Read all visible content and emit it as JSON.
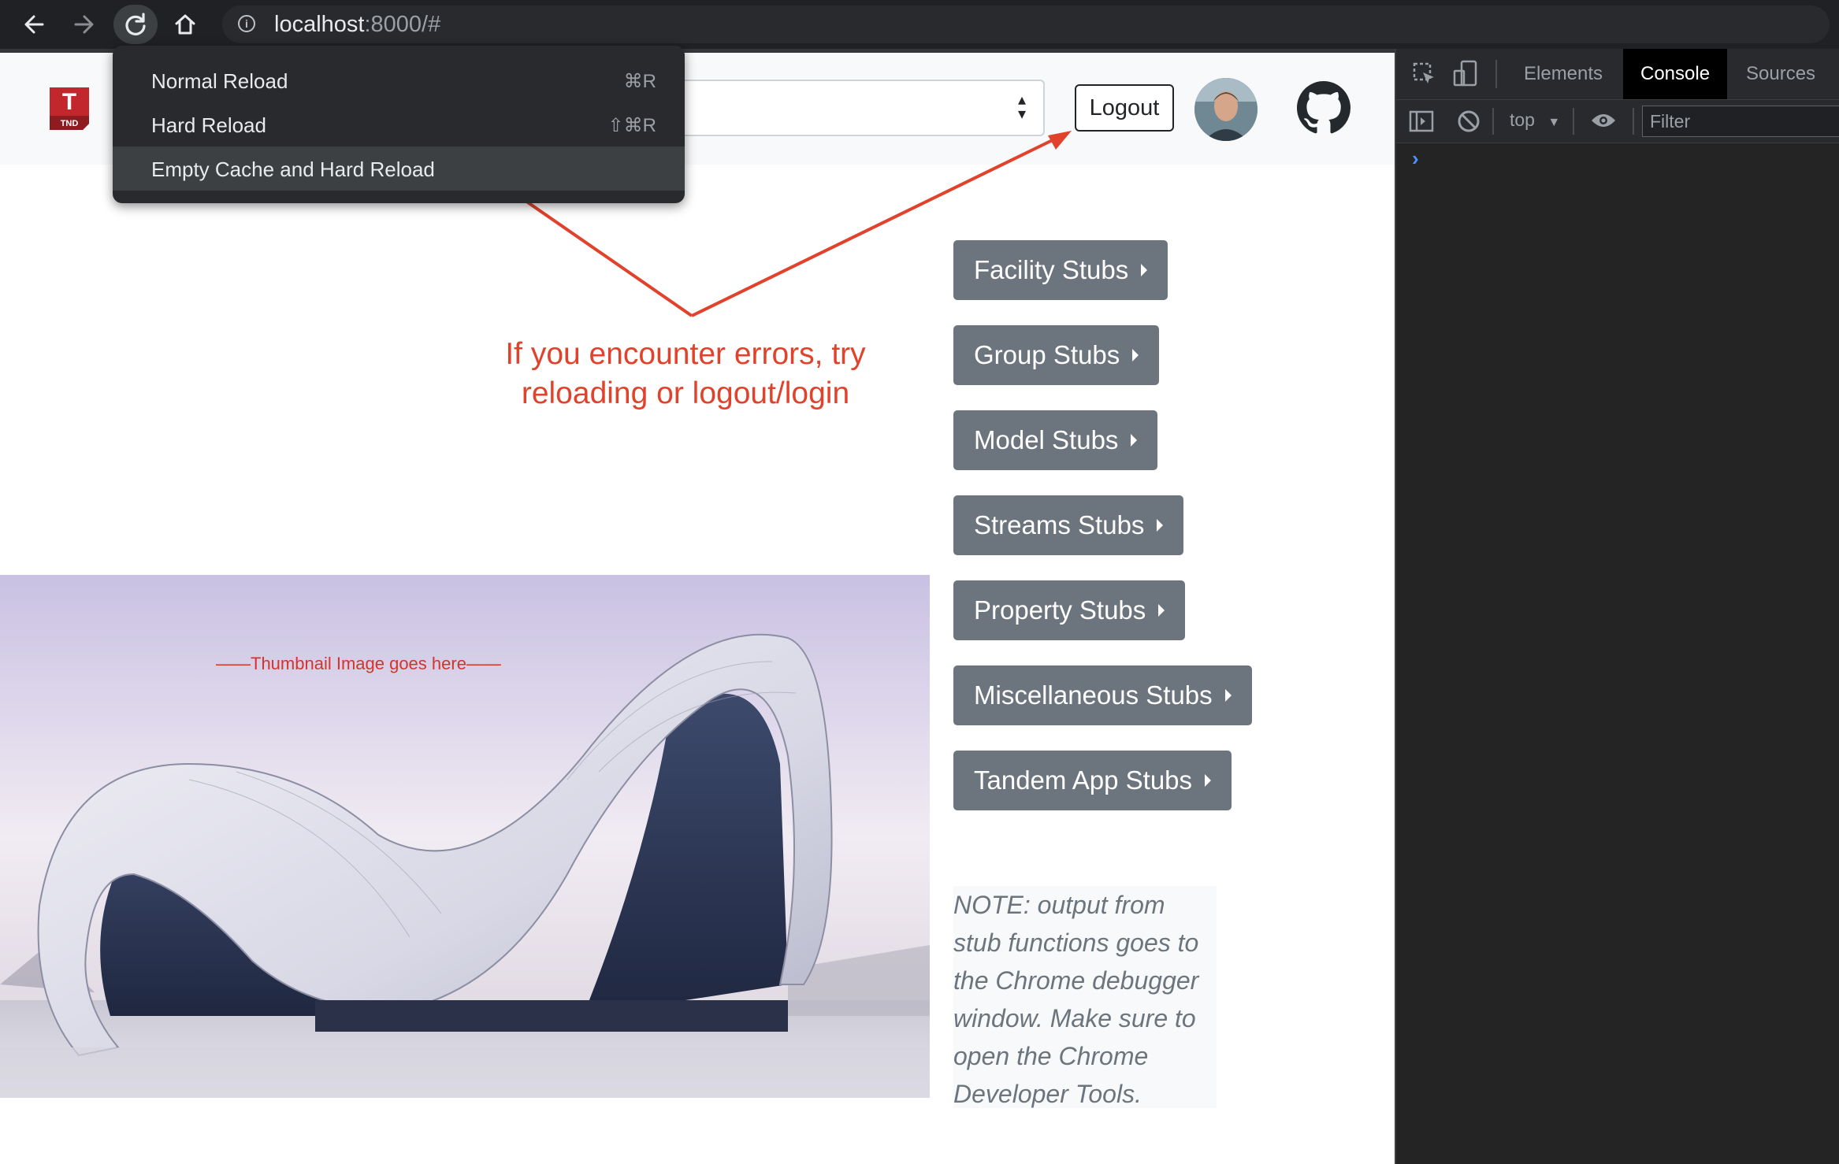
{
  "browser": {
    "url_host": "localhost",
    "url_rest": ":8000/#"
  },
  "reload_menu": {
    "items": [
      {
        "label": "Normal Reload",
        "shortcut": "⌘R"
      },
      {
        "label": "Hard Reload",
        "shortcut": "⇧⌘R"
      },
      {
        "label": "Empty Cache and Hard Reload",
        "shortcut": ""
      }
    ]
  },
  "navbar": {
    "logo_letter": "T",
    "logo_sub": "TND",
    "logout_label": "Logout"
  },
  "stubs": {
    "buttons": [
      "Facility Stubs",
      "Group Stubs",
      "Model Stubs",
      "Streams Stubs",
      "Property Stubs",
      "Miscellaneous Stubs",
      "Tandem App Stubs"
    ]
  },
  "annotation": {
    "text": "If you encounter errors, try reloading or logout/login",
    "color": "#e0422b"
  },
  "hero": {
    "caption": "——Thumbnail Image goes here——"
  },
  "note": {
    "text": "NOTE: output from stub functions goes to the Chrome debugger window. Make sure to open the Chrome Developer Tools."
  },
  "devtools": {
    "tabs": [
      "Elements",
      "Console",
      "Sources"
    ],
    "active_tab": "Console",
    "context": "top",
    "filter_placeholder": "Filter",
    "prompt": "›"
  },
  "colors": {
    "stub_button": "#6c757d",
    "logo_red": "#c1272d",
    "chrome_dark": "#202124"
  }
}
